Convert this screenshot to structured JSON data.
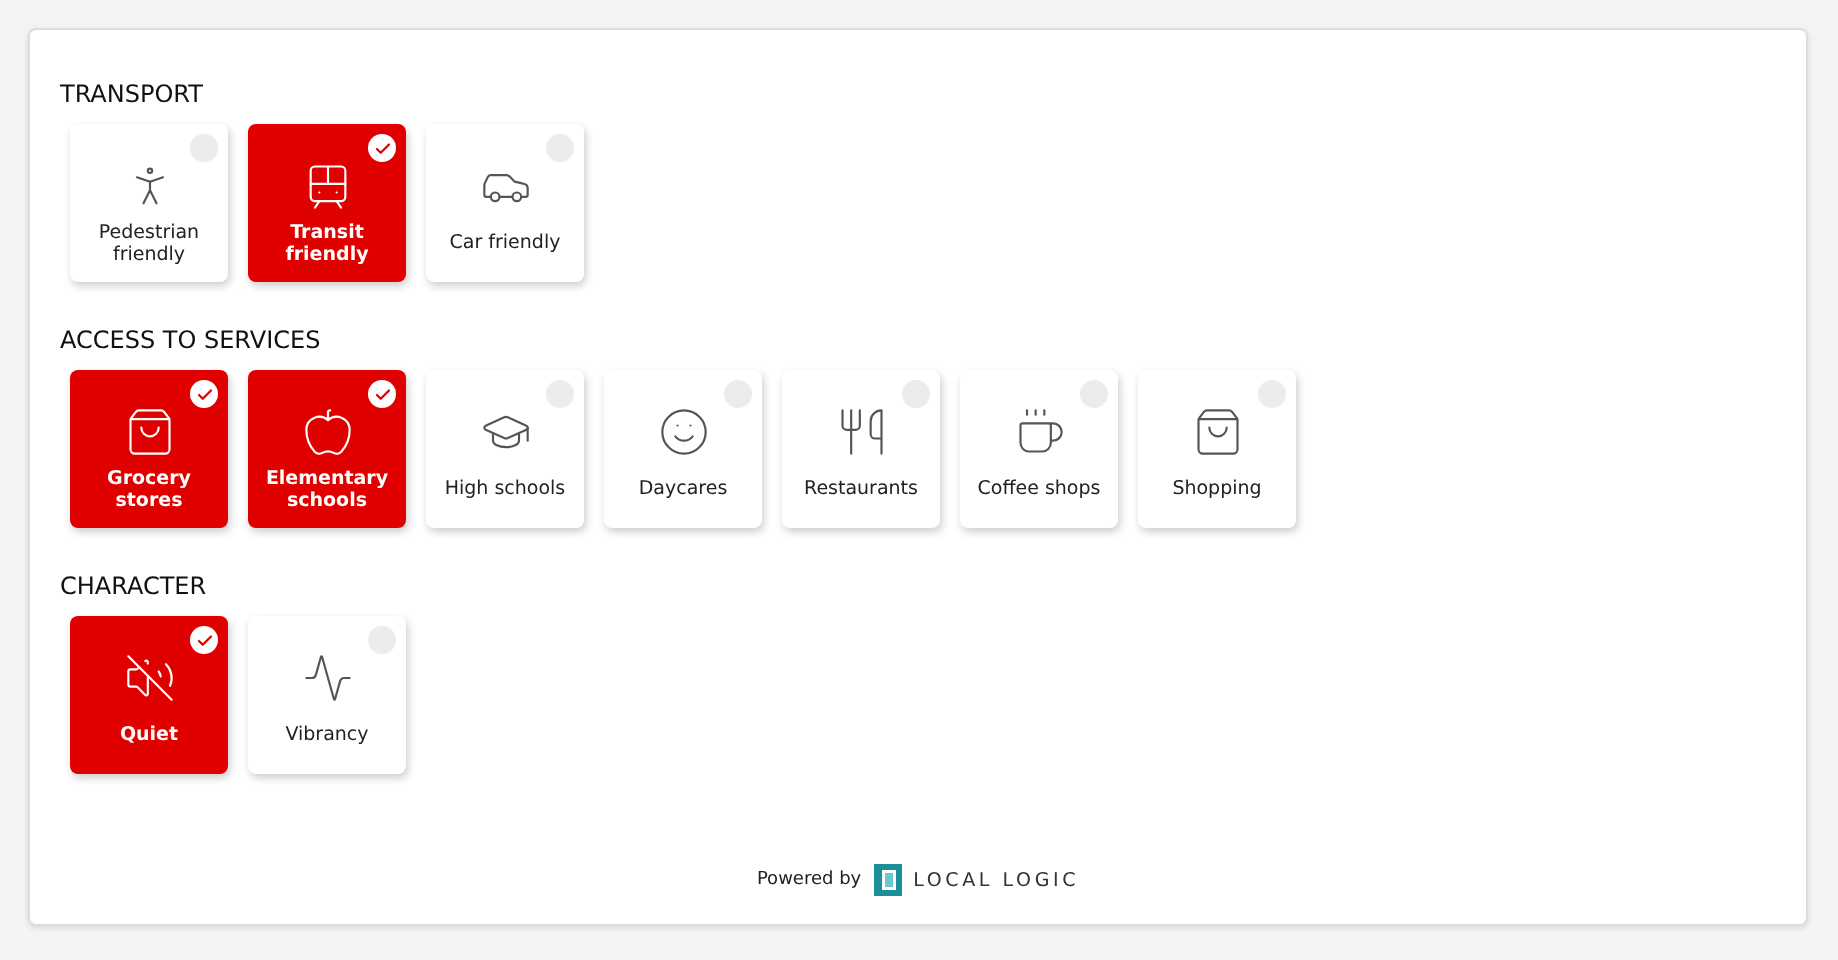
{
  "sections": [
    {
      "title": "TRANSPORT",
      "items": [
        {
          "label": "Pedestrian friendly",
          "selected": false
        },
        {
          "label": "Transit friendly",
          "selected": true
        },
        {
          "label": "Car friendly",
          "selected": false
        }
      ]
    },
    {
      "title": "ACCESS TO SERVICES",
      "items": [
        {
          "label": "Grocery stores",
          "selected": true
        },
        {
          "label": "Elementary schools",
          "selected": true
        },
        {
          "label": "High schools",
          "selected": false
        },
        {
          "label": "Daycares",
          "selected": false
        },
        {
          "label": "Restaurants",
          "selected": false
        },
        {
          "label": "Coffee shops",
          "selected": false
        },
        {
          "label": "Shopping",
          "selected": false
        }
      ]
    },
    {
      "title": "CHARACTER",
      "items": [
        {
          "label": "Quiet",
          "selected": true
        },
        {
          "label": "Vibrancy",
          "selected": false
        }
      ]
    }
  ],
  "footer": {
    "powered_by": "Powered by",
    "brand": "LOCAL LOGIC"
  }
}
